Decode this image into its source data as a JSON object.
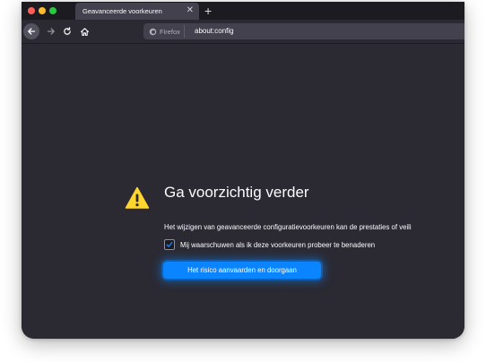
{
  "colors": {
    "window_bg": "#2b2a33",
    "tabstrip_bg": "#1c1b22",
    "tab_bg": "#42414d",
    "accent": "#0a84ff",
    "warning": "#ffd52e",
    "text": "#fbfbfe"
  },
  "tabs": [
    {
      "title": "Geavanceerde voorkeuren",
      "close_icon": "close-icon",
      "active": true
    }
  ],
  "tabstrip": {
    "new_tab_icon": "plus-icon"
  },
  "toolbar": {
    "back_icon": "arrow-left-icon",
    "forward_icon": "arrow-right-icon",
    "reload_icon": "reload-icon",
    "home_icon": "home-icon"
  },
  "urlbar": {
    "identity_icon": "firefox-icon",
    "identity_label": "Firefox",
    "url": "about:config"
  },
  "content": {
    "warning_icon": "warning-triangle-icon",
    "heading": "Ga voorzichtig verder",
    "description": "Het wijzigen van geavanceerde configuratievoorkeuren kan de prestaties of veili",
    "checkbox": {
      "label": "Mij waarschuwen als ik deze voorkeuren probeer te benaderen",
      "checked": true
    },
    "accept_button": "Het risico aanvaarden en doorgaan"
  }
}
